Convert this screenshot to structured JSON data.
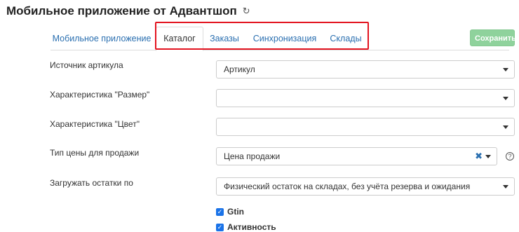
{
  "header": {
    "title": "Мобильное приложение от Адвантшоп",
    "refresh_icon": "refresh-icon"
  },
  "tabs": [
    {
      "label": "Мобильное приложение",
      "active": false
    },
    {
      "label": "Каталог",
      "active": true
    },
    {
      "label": "Заказы",
      "active": false
    },
    {
      "label": "Синхронизация",
      "active": false
    },
    {
      "label": "Склады",
      "active": false
    }
  ],
  "toolbar": {
    "save_label": "Сохранить"
  },
  "form": {
    "article_source": {
      "label": "Источник артикула",
      "value": "Артикул"
    },
    "size_characteristic": {
      "label": "Характеристика \"Размер\"",
      "value": ""
    },
    "color_characteristic": {
      "label": "Характеристика \"Цвет\"",
      "value": ""
    },
    "price_type": {
      "label": "Тип цены для продажи",
      "value": "Цена продажи",
      "clear_symbol": "✖"
    },
    "stock_source": {
      "label": "Загружать остатки по",
      "value": "Физический остаток на складах, без учёта резерва и ожидания"
    },
    "checkboxes": [
      {
        "label": "Gtin",
        "checked": true
      },
      {
        "label": "Активность",
        "checked": true
      }
    ]
  },
  "colors": {
    "accent": "#2a6fb0",
    "save_button": "#8fd29c",
    "highlight": "#e3131f",
    "checkbox": "#1a73e8"
  }
}
